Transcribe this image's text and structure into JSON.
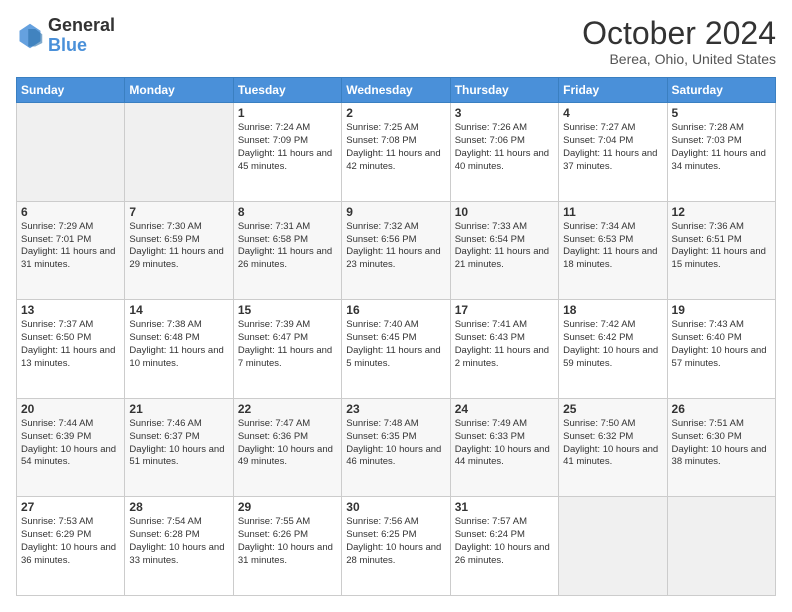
{
  "header": {
    "logo_line1": "General",
    "logo_line2": "Blue",
    "month": "October 2024",
    "location": "Berea, Ohio, United States"
  },
  "days_of_week": [
    "Sunday",
    "Monday",
    "Tuesday",
    "Wednesday",
    "Thursday",
    "Friday",
    "Saturday"
  ],
  "weeks": [
    [
      {
        "day": "",
        "info": ""
      },
      {
        "day": "",
        "info": ""
      },
      {
        "day": "1",
        "info": "Sunrise: 7:24 AM\nSunset: 7:09 PM\nDaylight: 11 hours and 45 minutes."
      },
      {
        "day": "2",
        "info": "Sunrise: 7:25 AM\nSunset: 7:08 PM\nDaylight: 11 hours and 42 minutes."
      },
      {
        "day": "3",
        "info": "Sunrise: 7:26 AM\nSunset: 7:06 PM\nDaylight: 11 hours and 40 minutes."
      },
      {
        "day": "4",
        "info": "Sunrise: 7:27 AM\nSunset: 7:04 PM\nDaylight: 11 hours and 37 minutes."
      },
      {
        "day": "5",
        "info": "Sunrise: 7:28 AM\nSunset: 7:03 PM\nDaylight: 11 hours and 34 minutes."
      }
    ],
    [
      {
        "day": "6",
        "info": "Sunrise: 7:29 AM\nSunset: 7:01 PM\nDaylight: 11 hours and 31 minutes."
      },
      {
        "day": "7",
        "info": "Sunrise: 7:30 AM\nSunset: 6:59 PM\nDaylight: 11 hours and 29 minutes."
      },
      {
        "day": "8",
        "info": "Sunrise: 7:31 AM\nSunset: 6:58 PM\nDaylight: 11 hours and 26 minutes."
      },
      {
        "day": "9",
        "info": "Sunrise: 7:32 AM\nSunset: 6:56 PM\nDaylight: 11 hours and 23 minutes."
      },
      {
        "day": "10",
        "info": "Sunrise: 7:33 AM\nSunset: 6:54 PM\nDaylight: 11 hours and 21 minutes."
      },
      {
        "day": "11",
        "info": "Sunrise: 7:34 AM\nSunset: 6:53 PM\nDaylight: 11 hours and 18 minutes."
      },
      {
        "day": "12",
        "info": "Sunrise: 7:36 AM\nSunset: 6:51 PM\nDaylight: 11 hours and 15 minutes."
      }
    ],
    [
      {
        "day": "13",
        "info": "Sunrise: 7:37 AM\nSunset: 6:50 PM\nDaylight: 11 hours and 13 minutes."
      },
      {
        "day": "14",
        "info": "Sunrise: 7:38 AM\nSunset: 6:48 PM\nDaylight: 11 hours and 10 minutes."
      },
      {
        "day": "15",
        "info": "Sunrise: 7:39 AM\nSunset: 6:47 PM\nDaylight: 11 hours and 7 minutes."
      },
      {
        "day": "16",
        "info": "Sunrise: 7:40 AM\nSunset: 6:45 PM\nDaylight: 11 hours and 5 minutes."
      },
      {
        "day": "17",
        "info": "Sunrise: 7:41 AM\nSunset: 6:43 PM\nDaylight: 11 hours and 2 minutes."
      },
      {
        "day": "18",
        "info": "Sunrise: 7:42 AM\nSunset: 6:42 PM\nDaylight: 10 hours and 59 minutes."
      },
      {
        "day": "19",
        "info": "Sunrise: 7:43 AM\nSunset: 6:40 PM\nDaylight: 10 hours and 57 minutes."
      }
    ],
    [
      {
        "day": "20",
        "info": "Sunrise: 7:44 AM\nSunset: 6:39 PM\nDaylight: 10 hours and 54 minutes."
      },
      {
        "day": "21",
        "info": "Sunrise: 7:46 AM\nSunset: 6:37 PM\nDaylight: 10 hours and 51 minutes."
      },
      {
        "day": "22",
        "info": "Sunrise: 7:47 AM\nSunset: 6:36 PM\nDaylight: 10 hours and 49 minutes."
      },
      {
        "day": "23",
        "info": "Sunrise: 7:48 AM\nSunset: 6:35 PM\nDaylight: 10 hours and 46 minutes."
      },
      {
        "day": "24",
        "info": "Sunrise: 7:49 AM\nSunset: 6:33 PM\nDaylight: 10 hours and 44 minutes."
      },
      {
        "day": "25",
        "info": "Sunrise: 7:50 AM\nSunset: 6:32 PM\nDaylight: 10 hours and 41 minutes."
      },
      {
        "day": "26",
        "info": "Sunrise: 7:51 AM\nSunset: 6:30 PM\nDaylight: 10 hours and 38 minutes."
      }
    ],
    [
      {
        "day": "27",
        "info": "Sunrise: 7:53 AM\nSunset: 6:29 PM\nDaylight: 10 hours and 36 minutes."
      },
      {
        "day": "28",
        "info": "Sunrise: 7:54 AM\nSunset: 6:28 PM\nDaylight: 10 hours and 33 minutes."
      },
      {
        "day": "29",
        "info": "Sunrise: 7:55 AM\nSunset: 6:26 PM\nDaylight: 10 hours and 31 minutes."
      },
      {
        "day": "30",
        "info": "Sunrise: 7:56 AM\nSunset: 6:25 PM\nDaylight: 10 hours and 28 minutes."
      },
      {
        "day": "31",
        "info": "Sunrise: 7:57 AM\nSunset: 6:24 PM\nDaylight: 10 hours and 26 minutes."
      },
      {
        "day": "",
        "info": ""
      },
      {
        "day": "",
        "info": ""
      }
    ]
  ]
}
